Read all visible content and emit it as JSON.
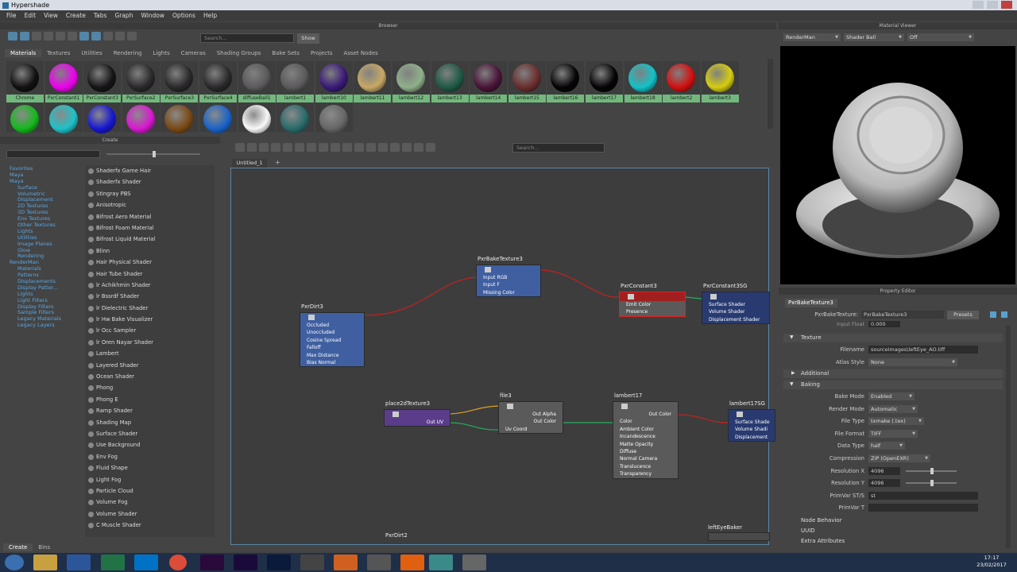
{
  "window": {
    "title": "Hypershade"
  },
  "menu": [
    "File",
    "Edit",
    "View",
    "Create",
    "Tabs",
    "Graph",
    "Window",
    "Options",
    "Help"
  ],
  "browser": {
    "title": "Browser",
    "search_placeholder": "Search...",
    "show_label": "Show",
    "tabs": [
      "Materials",
      "Textures",
      "Utilities",
      "Rendering",
      "Lights",
      "Cameras",
      "Shading Groups",
      "Bake Sets",
      "Projects",
      "Asset Nodes"
    ],
    "row1": [
      {
        "label": "Chrome",
        "color": "#111"
      },
      {
        "label": "PxrConstant1",
        "color": "#ee00ee"
      },
      {
        "label": "PxrConstant3",
        "color": "#161616"
      },
      {
        "label": "PxrSurface2",
        "color": "#2a2a2a"
      },
      {
        "label": "PxrSurface3",
        "color": "#2a2a2a"
      },
      {
        "label": "PxrSurface4",
        "color": "#2a2a2a"
      },
      {
        "label": "diffuseBall1",
        "color": "#5a5a5a"
      },
      {
        "label": "lambert1",
        "color": "#5a5a5a"
      },
      {
        "label": "lambert10",
        "color": "#3a1a78"
      },
      {
        "label": "lambert11",
        "color": "#c8a866"
      },
      {
        "label": "lambert12",
        "color": "#8fb08a"
      },
      {
        "label": "lambert13",
        "color": "#1f5a45"
      },
      {
        "label": "lambert14",
        "color": "#4a1438"
      },
      {
        "label": "lambert15",
        "color": "#6a2e2e"
      },
      {
        "label": "lambert16",
        "color": "#050505"
      },
      {
        "label": "lambert17",
        "color": "#050505"
      },
      {
        "label": "lambert18",
        "color": "#12c2c8"
      },
      {
        "label": "lambert2",
        "color": "#d21010"
      },
      {
        "label": "lambert3",
        "color": "#d6cc10"
      }
    ],
    "row2": [
      "#16b81e",
      "#1ec2c8",
      "#1818d0",
      "#d818d0",
      "#7a4a16",
      "#1a64c8",
      "#f8f8f8",
      "#2a6a6a",
      "#666"
    ]
  },
  "create": {
    "title": "Create",
    "tabs": [
      "Create",
      "Bins"
    ],
    "tree": [
      {
        "t": "Favorites",
        "f": false
      },
      {
        "t": "Maya",
        "f": false
      },
      {
        "t": "Maya",
        "f": false
      },
      {
        "t": "Surface",
        "f": false
      },
      {
        "t": "Volumetric",
        "f": false
      },
      {
        "t": "Displacement",
        "f": false
      },
      {
        "t": "2D Textures",
        "f": false
      },
      {
        "t": "3D Textures",
        "f": false
      },
      {
        "t": "Env Textures",
        "f": false
      },
      {
        "t": "Other Textures",
        "f": false
      },
      {
        "t": "Lights",
        "f": false
      },
      {
        "t": "Utilities",
        "f": false
      },
      {
        "t": "Image Planes",
        "f": false
      },
      {
        "t": "Glow",
        "f": false
      },
      {
        "t": "Rendering",
        "f": false
      },
      {
        "t": "RenderMan",
        "f": false
      },
      {
        "t": "Materials",
        "f": false
      },
      {
        "t": "Patterns",
        "f": false
      },
      {
        "t": "Displacements",
        "f": false
      },
      {
        "t": "Display Patter...",
        "f": false
      },
      {
        "t": "Lights",
        "f": false
      },
      {
        "t": "Light Filters",
        "f": false
      },
      {
        "t": "Display Filters",
        "f": false
      },
      {
        "t": "Sample Filters",
        "f": false
      },
      {
        "t": "Legacy Materials",
        "f": false
      },
      {
        "t": "Legacy Layers",
        "f": false
      }
    ],
    "items": [
      "Shaderfx Game Hair",
      "Shaderfx Shader",
      "Stingray PBS",
      "Anisotropic",
      "Bifrost Aero Material",
      "Bifrost Foam Material",
      "Bifrost Liquid Material",
      "Blinn",
      "Hair Physical Shader",
      "Hair Tube Shader",
      "lr Achikhmin Shader",
      "lr Bssrdf Shader",
      "lr Dielectric Shader",
      "lr Hw Bake Visualizer",
      "lr Occ Sampler",
      "lr Oren Nayar Shader",
      "Lambert",
      "Layered Shader",
      "Ocean Shader",
      "Phong",
      "Phong E",
      "Ramp Shader",
      "Shading Map",
      "Surface Shader",
      "Use Background",
      "Env Fog",
      "Fluid Shape",
      "Light Fog",
      "Particle Cloud",
      "Volume Fog",
      "Volume Shader",
      "C Muscle Shader"
    ]
  },
  "graph": {
    "tab": "Untitled_1",
    "plus": "+",
    "search_placeholder": "Search...",
    "nodes": {
      "pxrdirt3": {
        "title": "PxrDirt3",
        "rows": [
          "Occluded",
          "Unoccluded",
          "Cosine Spread",
          "Falloff",
          "Max Distance",
          "Bias Normal"
        ]
      },
      "bake": {
        "title": "PxrBakeTexture3",
        "rows": [
          "Input RGB",
          "Input F",
          "Missing Color"
        ]
      },
      "const3": {
        "title": "PxrConstant3",
        "rows": [
          "Emit Color",
          "Presence"
        ]
      },
      "constsg": {
        "title": "PxrConstant3SG",
        "rows": [
          "Surface Shader",
          "Volume Shader",
          "Displacement Shader"
        ]
      },
      "place": {
        "title": "place2dTexture3",
        "rows": [
          "Out UV"
        ]
      },
      "file3": {
        "title": "file3",
        "rows": [
          "Out Alpha",
          "Out Color",
          "Uv Coord"
        ]
      },
      "lambert17": {
        "title": "lambert17",
        "rows": [
          "Out Color",
          "Color",
          "Ambient Color",
          "Incandescence",
          "Matte Opacity",
          "Diffuse",
          "Normal Camera",
          "Translucence",
          "Transparency"
        ]
      },
      "lambertsg": {
        "title": "lambert17SG",
        "rows": [
          "Surface Shade",
          "Volume Shadi",
          "Displacement"
        ]
      },
      "lefteye": {
        "title": "leftEyeBaker"
      },
      "pxrdirt2": {
        "title": "PxrDirt2"
      }
    }
  },
  "viewer": {
    "title": "Material Viewer",
    "renderer": "RenderMan",
    "geometry": "Shader Ball",
    "mode": "Off"
  },
  "props": {
    "title": "Property Editor",
    "node_tab": "PxrBakeTexture3",
    "node_label": "PxrBakeTexture:",
    "node_value": "PxrBakeTexture3",
    "presets": "Presets",
    "input_float": "Input Float",
    "input_float_val": "0.000",
    "sections": [
      "Texture",
      "Additional",
      "Baking",
      "Node Behavior",
      "UUID",
      "Extra Attributes"
    ],
    "filename_label": "Filename",
    "filename": "sourceimages\\leftEye_AO.tiff",
    "atlas_label": "Atlas Style",
    "atlas": "None",
    "bake_mode_label": "Bake Mode",
    "bake_mode": "Enabled",
    "render_mode_label": "Render Mode",
    "render_mode": "Automatic",
    "file_type_label": "File Type",
    "file_type": "txmake (.tex)",
    "file_format_label": "File Format",
    "file_format": "TIFF",
    "data_type_label": "Data Type",
    "data_type": "half",
    "compression_label": "Compression",
    "compression": "ZIP (OpenEXR)",
    "resx_label": "Resolution X",
    "resx": "4096",
    "resy_label": "Resolution Y",
    "resy": "4096",
    "primst_label": "PrimVar ST/S",
    "primst": "st",
    "primt_label": "PrimVar T",
    "primt": ""
  },
  "taskbar": {
    "time": "17:17",
    "date": "23/02/2017"
  }
}
